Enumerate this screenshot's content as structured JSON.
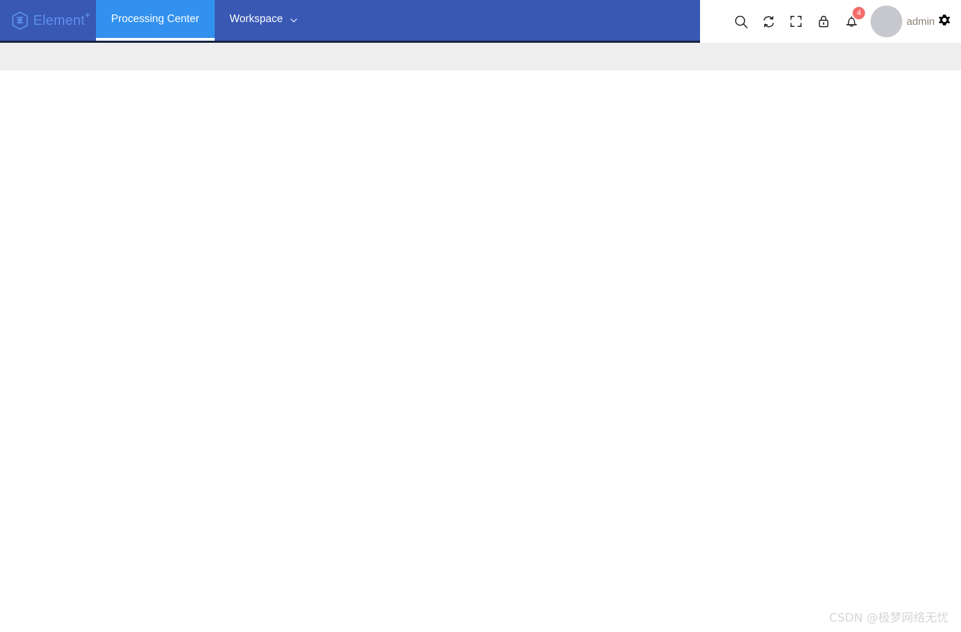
{
  "header": {
    "brand": {
      "name": "Element",
      "superscript": "+",
      "logo_icon": "hexagon-element-logo-icon",
      "color": "#5d91e8"
    },
    "nav_items": [
      {
        "label": "Processing Center",
        "active": true,
        "has_dropdown": false
      },
      {
        "label": "Workspace",
        "active": false,
        "has_dropdown": true,
        "dropdown_icon": "chevron-down-icon"
      }
    ],
    "tools": [
      {
        "name": "search",
        "icon": "search-icon",
        "label": "Search"
      },
      {
        "name": "refresh",
        "icon": "refresh-icon",
        "label": "Refresh"
      },
      {
        "name": "fullscreen",
        "icon": "fullscreen-icon",
        "label": "Fullscreen"
      },
      {
        "name": "lock",
        "icon": "lock-icon",
        "label": "Lock screen"
      },
      {
        "name": "notifications",
        "icon": "bell-icon",
        "label": "Notifications",
        "badge": "4"
      }
    ],
    "user": {
      "name": "admin",
      "avatar_icon": "avatar",
      "settings_icon": "gear-icon"
    },
    "colors": {
      "nav_background": "#3858b4",
      "nav_active": "#3291ee",
      "nav_border_bottom": "#14213f",
      "badge": "#f56c6c",
      "subbar": "#eeeeee"
    }
  },
  "sub_bar": {
    "label": ""
  },
  "main": {
    "content": ""
  },
  "watermark": {
    "text": "CSDN @极梦网络无忧"
  }
}
